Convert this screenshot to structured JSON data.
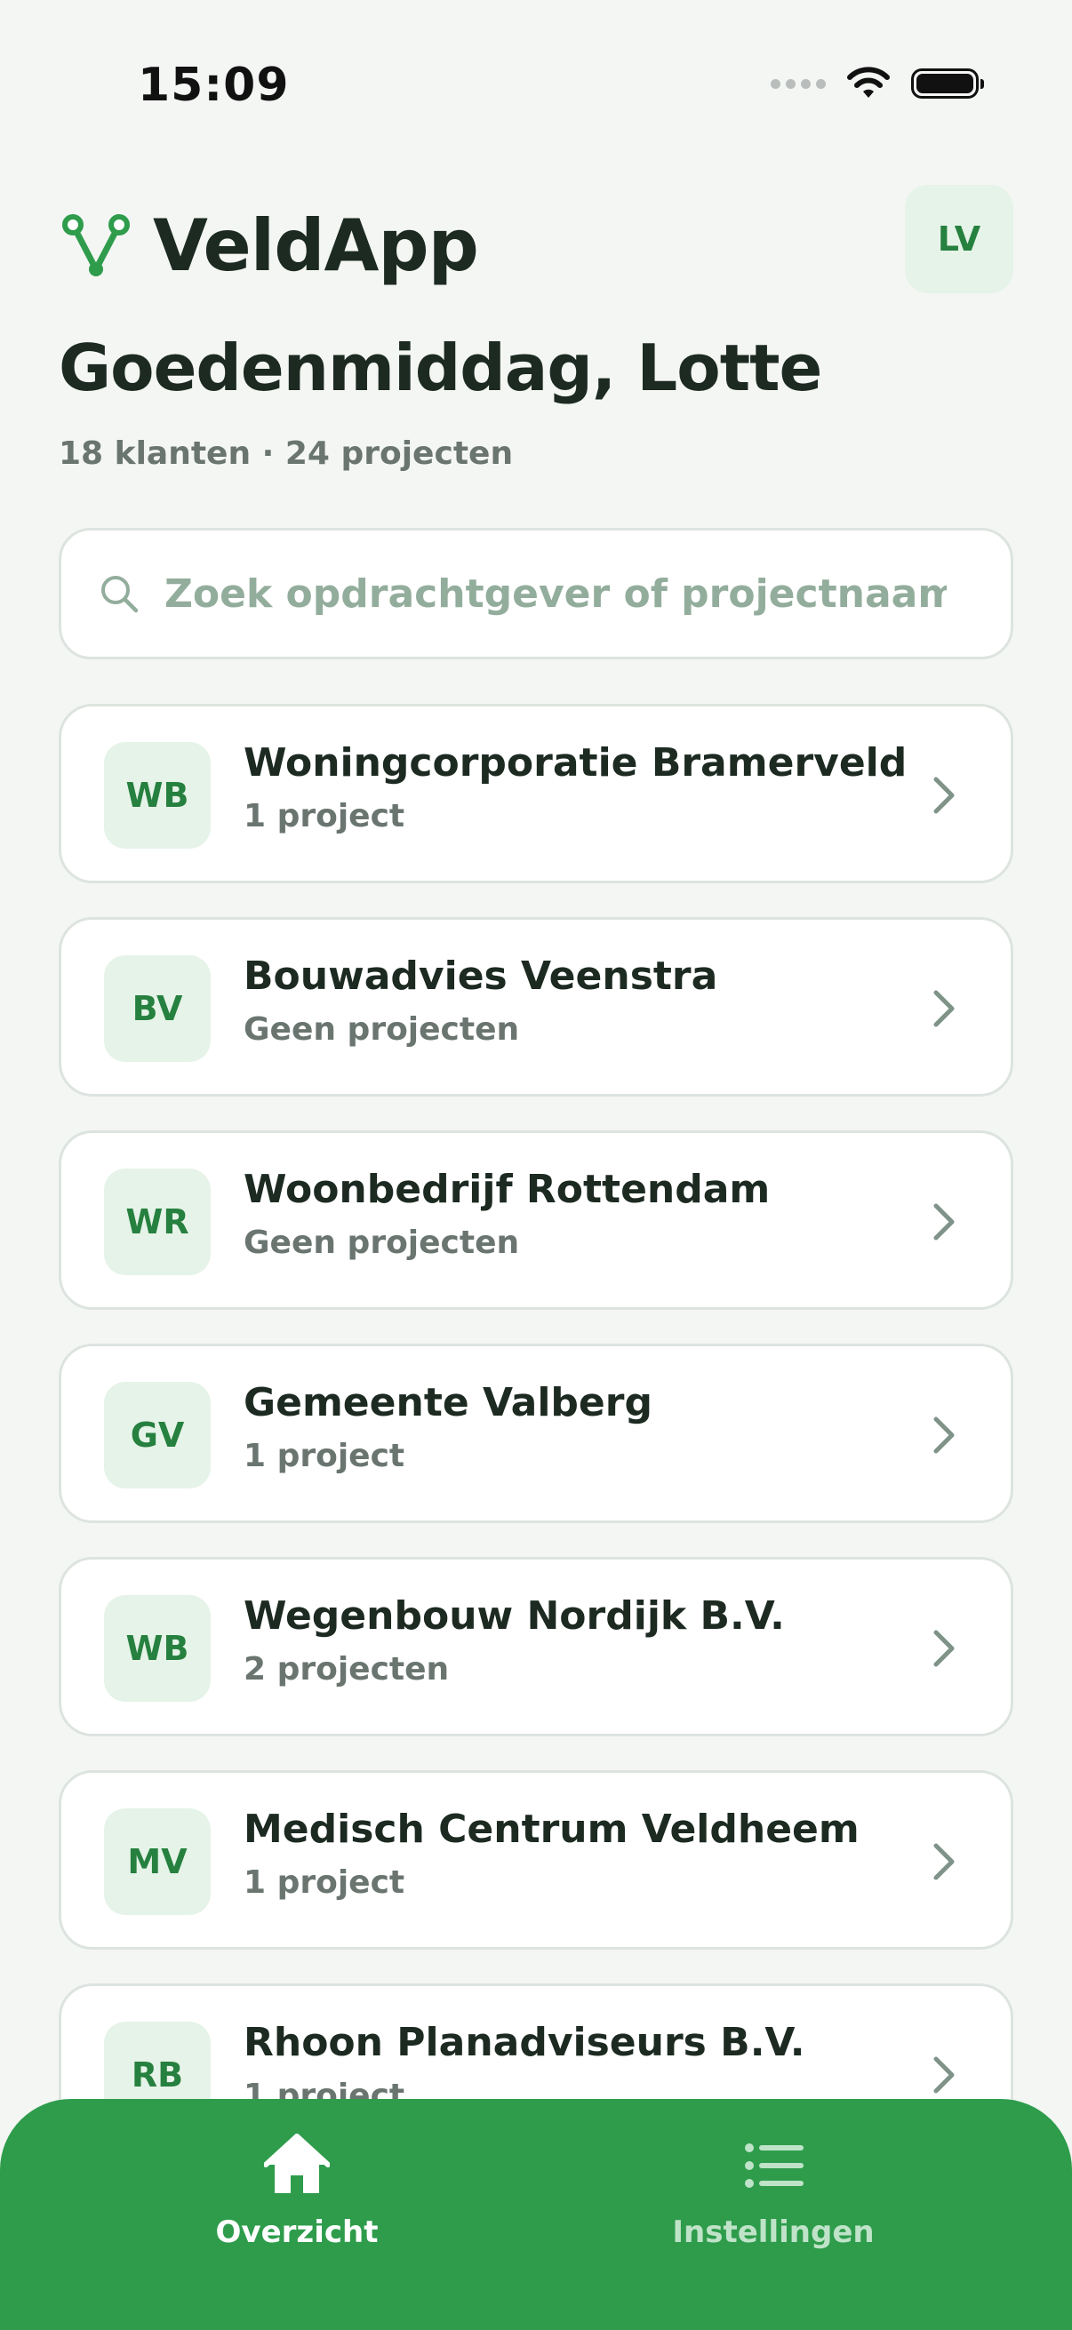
{
  "status_bar": {
    "time": "15:09"
  },
  "header": {
    "app_name": "VeldApp",
    "avatar_initials": "LV",
    "logo_icon": "veld-v-logo-icon"
  },
  "greeting": "Goedenmiddag, Lotte",
  "summary": "18 klanten · 24 projecten",
  "search": {
    "placeholder": "Zoek opdrachtgever of projectnaam",
    "value": ""
  },
  "clients": [
    {
      "initials": "WB",
      "name": "Woningcorporatie Bramerveld",
      "projects": "1 project"
    },
    {
      "initials": "BV",
      "name": "Bouwadvies Veenstra",
      "projects": "Geen projecten"
    },
    {
      "initials": "WR",
      "name": "Woonbedrijf Rottendam",
      "projects": "Geen projecten"
    },
    {
      "initials": "GV",
      "name": "Gemeente Valberg",
      "projects": "1 project"
    },
    {
      "initials": "WB",
      "name": "Wegenbouw Nordijk B.V.",
      "projects": "2 projecten"
    },
    {
      "initials": "MV",
      "name": "Medisch Centrum Veldheem",
      "projects": "1 project"
    },
    {
      "initials": "RB",
      "name": "Rhoon Planadviseurs B.V.",
      "projects": "1 project"
    }
  ],
  "nav": {
    "home_label": "Overzicht",
    "settings_label": "Instellingen",
    "active": "Overzicht"
  },
  "colors": {
    "brand_green": "#2e9c4b",
    "accent_green": "#26803f",
    "badge_bg": "#e6f3e8",
    "background": "#f4f6f4"
  }
}
